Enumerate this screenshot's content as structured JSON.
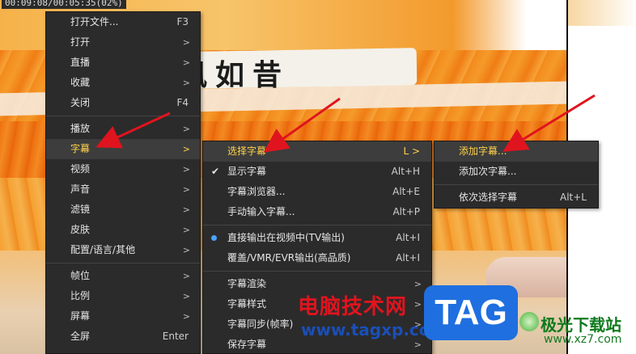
{
  "status_text": "00:09:08/00:05:35(02%)",
  "video": {
    "caption": "风如昔"
  },
  "main_menu": {
    "items": [
      {
        "label": "打开文件...",
        "shortcut": "F3"
      },
      {
        "label": "打开",
        "arrow": ">"
      },
      {
        "label": "直播",
        "arrow": ">"
      },
      {
        "label": "收藏",
        "arrow": ">"
      },
      {
        "label": "关闭",
        "shortcut": "F4"
      },
      {
        "label": "播放",
        "arrow": ">"
      },
      {
        "label": "字幕",
        "arrow": ">"
      },
      {
        "label": "视频",
        "arrow": ">"
      },
      {
        "label": "声音",
        "arrow": ">"
      },
      {
        "label": "滤镜",
        "arrow": ">"
      },
      {
        "label": "皮肤",
        "arrow": ">"
      },
      {
        "label": "配置/语言/其他",
        "arrow": ">"
      },
      {
        "label": "帧位",
        "arrow": ">"
      },
      {
        "label": "比例",
        "arrow": ">"
      },
      {
        "label": "屏幕",
        "arrow": ">"
      },
      {
        "label": "全屏",
        "shortcut": "Enter"
      }
    ]
  },
  "subtitle_menu": {
    "items": [
      {
        "label": "选择字幕",
        "shortcut": "L >"
      },
      {
        "label": "显示字幕",
        "shortcut": "Alt+H"
      },
      {
        "label": "字幕浏览器...",
        "shortcut": "Alt+E"
      },
      {
        "label": "手动输入字幕...",
        "shortcut": "Alt+P"
      },
      {
        "label": "直接输出在视频中(TV输出)",
        "shortcut": "Alt+I"
      },
      {
        "label": "覆盖/VMR/EVR输出(高品质)",
        "shortcut": "Alt+I"
      },
      {
        "label": "字幕渲染",
        "arrow": ">"
      },
      {
        "label": "字幕样式",
        "arrow": ">"
      },
      {
        "label": "字幕同步(帧率)",
        "arrow": ">"
      },
      {
        "label": "保存字幕",
        "arrow": ">"
      }
    ]
  },
  "select_subtitle_menu": {
    "items": [
      {
        "label": "添加字幕..."
      },
      {
        "label": "添加次字幕..."
      },
      {
        "label": "依次选择字幕",
        "shortcut": "Alt+L"
      }
    ]
  },
  "watermark": {
    "text": "电脑技术网",
    "url": "www.tagxp.com",
    "tag": "TAG",
    "brand": "极光下载站",
    "site": "www.xz7.com"
  },
  "colors": {
    "highlight": "#ffd34a",
    "menu_bg": "#2b2b2b",
    "arrow_red": "#e0141e"
  }
}
